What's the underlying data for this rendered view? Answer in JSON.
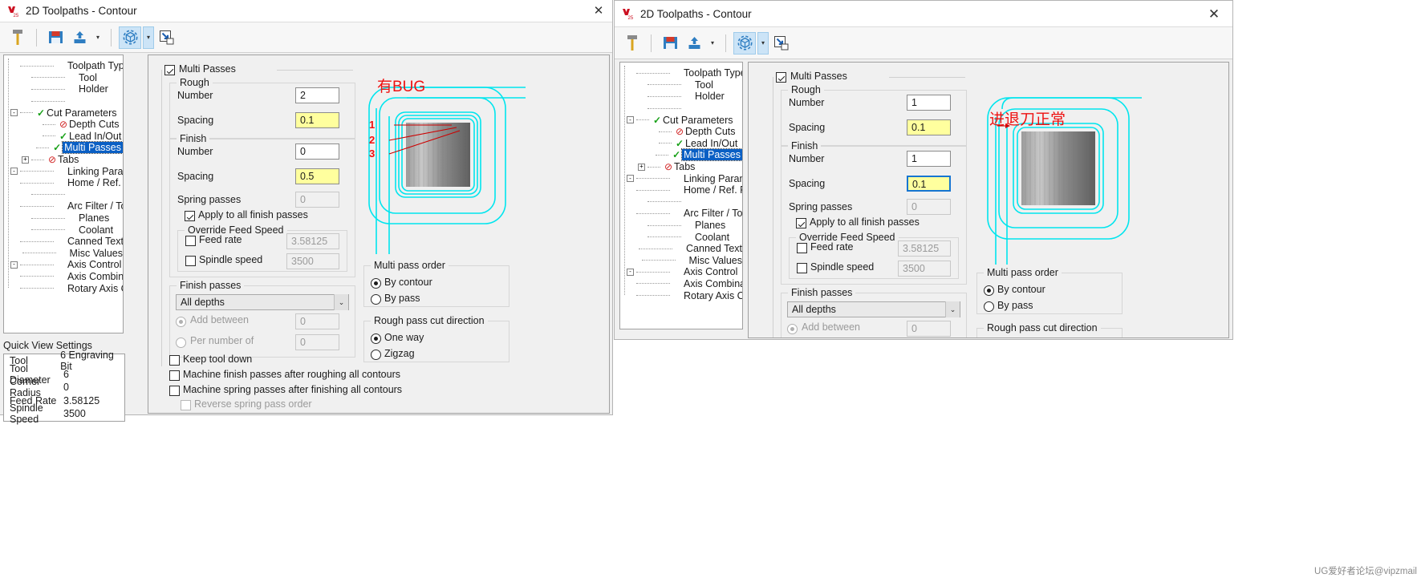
{
  "window_left": {
    "title": "2D Toolpaths - Contour",
    "close_label": "✕",
    "toolbar": {
      "tool_icon": "tool-bit-icon",
      "save_icon": "save-icon",
      "export_icon": "export-icon",
      "export_caret": "▾",
      "preview_icon": "solid-preview-icon",
      "preview_caret": "▾",
      "restore_icon": "restore-down-icon"
    },
    "tree": [
      {
        "label": "Toolpath Type",
        "indent": 1,
        "mark": "",
        "expander": "",
        "dots": "long"
      },
      {
        "label": "Tool",
        "indent": 1,
        "mark": "",
        "expander": "",
        "dots": "long"
      },
      {
        "label": "Holder",
        "indent": 1,
        "mark": "",
        "expander": "",
        "dots": "long"
      },
      {
        "label": "",
        "indent": 1,
        "mark": "",
        "expander": "",
        "dots": "long",
        "spacer": true
      },
      {
        "label": "Cut Parameters",
        "indent": 0,
        "mark": "ok",
        "expander": "-",
        "dots": "short"
      },
      {
        "label": "Depth Cuts",
        "indent": 2,
        "mark": "no",
        "expander": "",
        "dots": "short"
      },
      {
        "label": "Lead In/Out",
        "indent": 2,
        "mark": "ok",
        "expander": "",
        "dots": "short"
      },
      {
        "label": "Multi Passes",
        "indent": 2,
        "mark": "ok",
        "expander": "",
        "dots": "short",
        "selected": true
      },
      {
        "label": "Tabs",
        "indent": 1,
        "mark": "no",
        "expander": "+",
        "dots": "short"
      },
      {
        "label": "Linking Parameters",
        "indent": 0,
        "mark": "",
        "expander": "-",
        "dots": "long"
      },
      {
        "label": "Home / Ref. Points",
        "indent": 2,
        "mark": "",
        "expander": "",
        "dots": "long"
      },
      {
        "label": "",
        "indent": 1,
        "mark": "",
        "expander": "",
        "dots": "long",
        "spacer": true
      },
      {
        "label": "Arc Filter / Tolerance",
        "indent": 1,
        "mark": "",
        "expander": "",
        "dots": "long"
      },
      {
        "label": "Planes",
        "indent": 1,
        "mark": "",
        "expander": "",
        "dots": "long"
      },
      {
        "label": "Coolant",
        "indent": 1,
        "mark": "",
        "expander": "",
        "dots": "long"
      },
      {
        "label": "Canned Text",
        "indent": 1,
        "mark": "",
        "expander": "",
        "dots": "long"
      },
      {
        "label": "Misc Values",
        "indent": 1,
        "mark": "",
        "expander": "",
        "dots": "long"
      },
      {
        "label": "Axis Control",
        "indent": 0,
        "mark": "",
        "expander": "-",
        "dots": "long"
      },
      {
        "label": "Axis Combination",
        "indent": 2,
        "mark": "",
        "expander": "",
        "dots": "long"
      },
      {
        "label": "Rotary Axis Control",
        "indent": 2,
        "mark": "",
        "expander": "",
        "dots": "long"
      }
    ],
    "quick_view": {
      "title": "Quick View Settings",
      "rows": [
        {
          "key": "Tool",
          "value": "6 Engraving Bit"
        },
        {
          "key": "Tool Diameter",
          "value": "6"
        },
        {
          "key": "Corner Radius",
          "value": "0"
        },
        {
          "key": "Feed Rate",
          "value": "3.58125"
        },
        {
          "key": "Spindle Speed",
          "value": "3500"
        }
      ]
    },
    "form": {
      "multi_passes_label": "Multi Passes",
      "multi_passes_checked": true,
      "rough_legend": "Rough",
      "rough_number_label": "Number",
      "rough_number_value": "2",
      "rough_spacing_label": "Spacing",
      "rough_spacing_value": "0.1",
      "finish_legend": "Finish",
      "finish_number_label": "Number",
      "finish_number_value": "0",
      "finish_spacing_label": "Spacing",
      "finish_spacing_value": "0.5",
      "spring_passes_label": "Spring passes",
      "spring_passes_value": "0",
      "apply_all_label": "Apply to all finish passes",
      "apply_all_checked": true,
      "override_legend": "Override Feed Speed",
      "feed_rate_label": "Feed rate",
      "feed_rate_value": "3.58125",
      "spindle_speed_label": "Spindle speed",
      "spindle_speed_value": "3500",
      "finish_passes_legend": "Finish passes",
      "depths_combo_value": "All depths",
      "depths_combo_arrow": "⌄",
      "add_between_label": "Add between",
      "add_between_value": "0",
      "per_number_label": "Per number of",
      "per_number_value": "0",
      "keep_tool_down_label": "Keep tool down",
      "machine_finish_label": "Machine finish passes after roughing all contours",
      "machine_spring_label": "Machine spring passes after finishing all contours",
      "reverse_spring_label": "Reverse spring pass order",
      "multi_pass_order_legend": "Multi pass order",
      "by_contour_label": "By contour",
      "by_pass_label": "By pass",
      "rough_dir_legend": "Rough pass cut direction",
      "one_way_label": "One way",
      "zigzag_label": "Zigzag"
    },
    "annotation": {
      "text": "有BUG",
      "markers": [
        "1",
        "2",
        "3"
      ]
    }
  },
  "window_right": {
    "title": "2D Toolpaths - Contour",
    "close_label": "✕",
    "toolbar": {
      "tool_icon": "tool-bit-icon",
      "save_icon": "save-icon",
      "export_icon": "export-icon",
      "export_caret": "▾",
      "preview_icon": "solid-preview-icon",
      "preview_caret": "▾",
      "restore_icon": "restore-down-icon"
    },
    "tree": [
      {
        "label": "Toolpath Type",
        "indent": 1,
        "mark": "",
        "expander": "",
        "dots": "long"
      },
      {
        "label": "Tool",
        "indent": 1,
        "mark": "",
        "expander": "",
        "dots": "long"
      },
      {
        "label": "Holder",
        "indent": 1,
        "mark": "",
        "expander": "",
        "dots": "long"
      },
      {
        "label": "",
        "indent": 1,
        "mark": "",
        "expander": "",
        "dots": "long",
        "spacer": true
      },
      {
        "label": "Cut Parameters",
        "indent": 0,
        "mark": "ok",
        "expander": "-",
        "dots": "short"
      },
      {
        "label": "Depth Cuts",
        "indent": 2,
        "mark": "no",
        "expander": "",
        "dots": "short"
      },
      {
        "label": "Lead In/Out",
        "indent": 2,
        "mark": "ok",
        "expander": "",
        "dots": "short"
      },
      {
        "label": "Multi Passes",
        "indent": 2,
        "mark": "ok",
        "expander": "",
        "dots": "short",
        "selected": true
      },
      {
        "label": "Tabs",
        "indent": 1,
        "mark": "no",
        "expander": "+",
        "dots": "short"
      },
      {
        "label": "Linking Parameters",
        "indent": 0,
        "mark": "",
        "expander": "-",
        "dots": "long"
      },
      {
        "label": "Home / Ref. Points",
        "indent": 2,
        "mark": "",
        "expander": "",
        "dots": "long"
      },
      {
        "label": "",
        "indent": 1,
        "mark": "",
        "expander": "",
        "dots": "long",
        "spacer": true
      },
      {
        "label": "Arc Filter / Tolerance",
        "indent": 1,
        "mark": "",
        "expander": "",
        "dots": "long"
      },
      {
        "label": "Planes",
        "indent": 1,
        "mark": "",
        "expander": "",
        "dots": "long"
      },
      {
        "label": "Coolant",
        "indent": 1,
        "mark": "",
        "expander": "",
        "dots": "long"
      },
      {
        "label": "Canned Text",
        "indent": 1,
        "mark": "",
        "expander": "",
        "dots": "long"
      },
      {
        "label": "Misc Values",
        "indent": 1,
        "mark": "",
        "expander": "",
        "dots": "long"
      },
      {
        "label": "Axis Control",
        "indent": 0,
        "mark": "",
        "expander": "-",
        "dots": "long"
      },
      {
        "label": "Axis Combination",
        "indent": 2,
        "mark": "",
        "expander": "",
        "dots": "long"
      },
      {
        "label": "Rotary Axis Control",
        "indent": 2,
        "mark": "",
        "expander": "",
        "dots": "long"
      }
    ],
    "form": {
      "multi_passes_label": "Multi Passes",
      "multi_passes_checked": true,
      "rough_legend": "Rough",
      "rough_number_label": "Number",
      "rough_number_value": "1",
      "rough_spacing_label": "Spacing",
      "rough_spacing_value": "0.1",
      "finish_legend": "Finish",
      "finish_number_label": "Number",
      "finish_number_value": "1",
      "finish_spacing_label": "Spacing",
      "finish_spacing_value": "0.1",
      "spring_passes_label": "Spring passes",
      "spring_passes_value": "0",
      "apply_all_label": "Apply to all finish passes",
      "apply_all_checked": true,
      "override_legend": "Override Feed Speed",
      "feed_rate_label": "Feed rate",
      "feed_rate_value": "3.58125",
      "spindle_speed_label": "Spindle speed",
      "spindle_speed_value": "3500",
      "finish_passes_legend": "Finish passes",
      "depths_combo_value": "All depths",
      "depths_combo_arrow": "⌄",
      "add_between_label": "Add between",
      "add_between_value": "0",
      "multi_pass_order_legend": "Multi pass order",
      "by_contour_label": "By contour",
      "by_pass_label": "By pass",
      "rough_dir_legend": "Rough pass cut direction"
    },
    "annotation": {
      "text": "进退刀正常"
    }
  },
  "watermark": "UG爱好者论坛@vipzmail",
  "colors": {
    "accent_selection": "#0a5fc4",
    "field_highlight": "#ffff9e",
    "annotation_red": "#ee1111",
    "toolpath_cyan": "#00e5ee",
    "check_green": "#17a017",
    "deny_red": "#d02020"
  }
}
